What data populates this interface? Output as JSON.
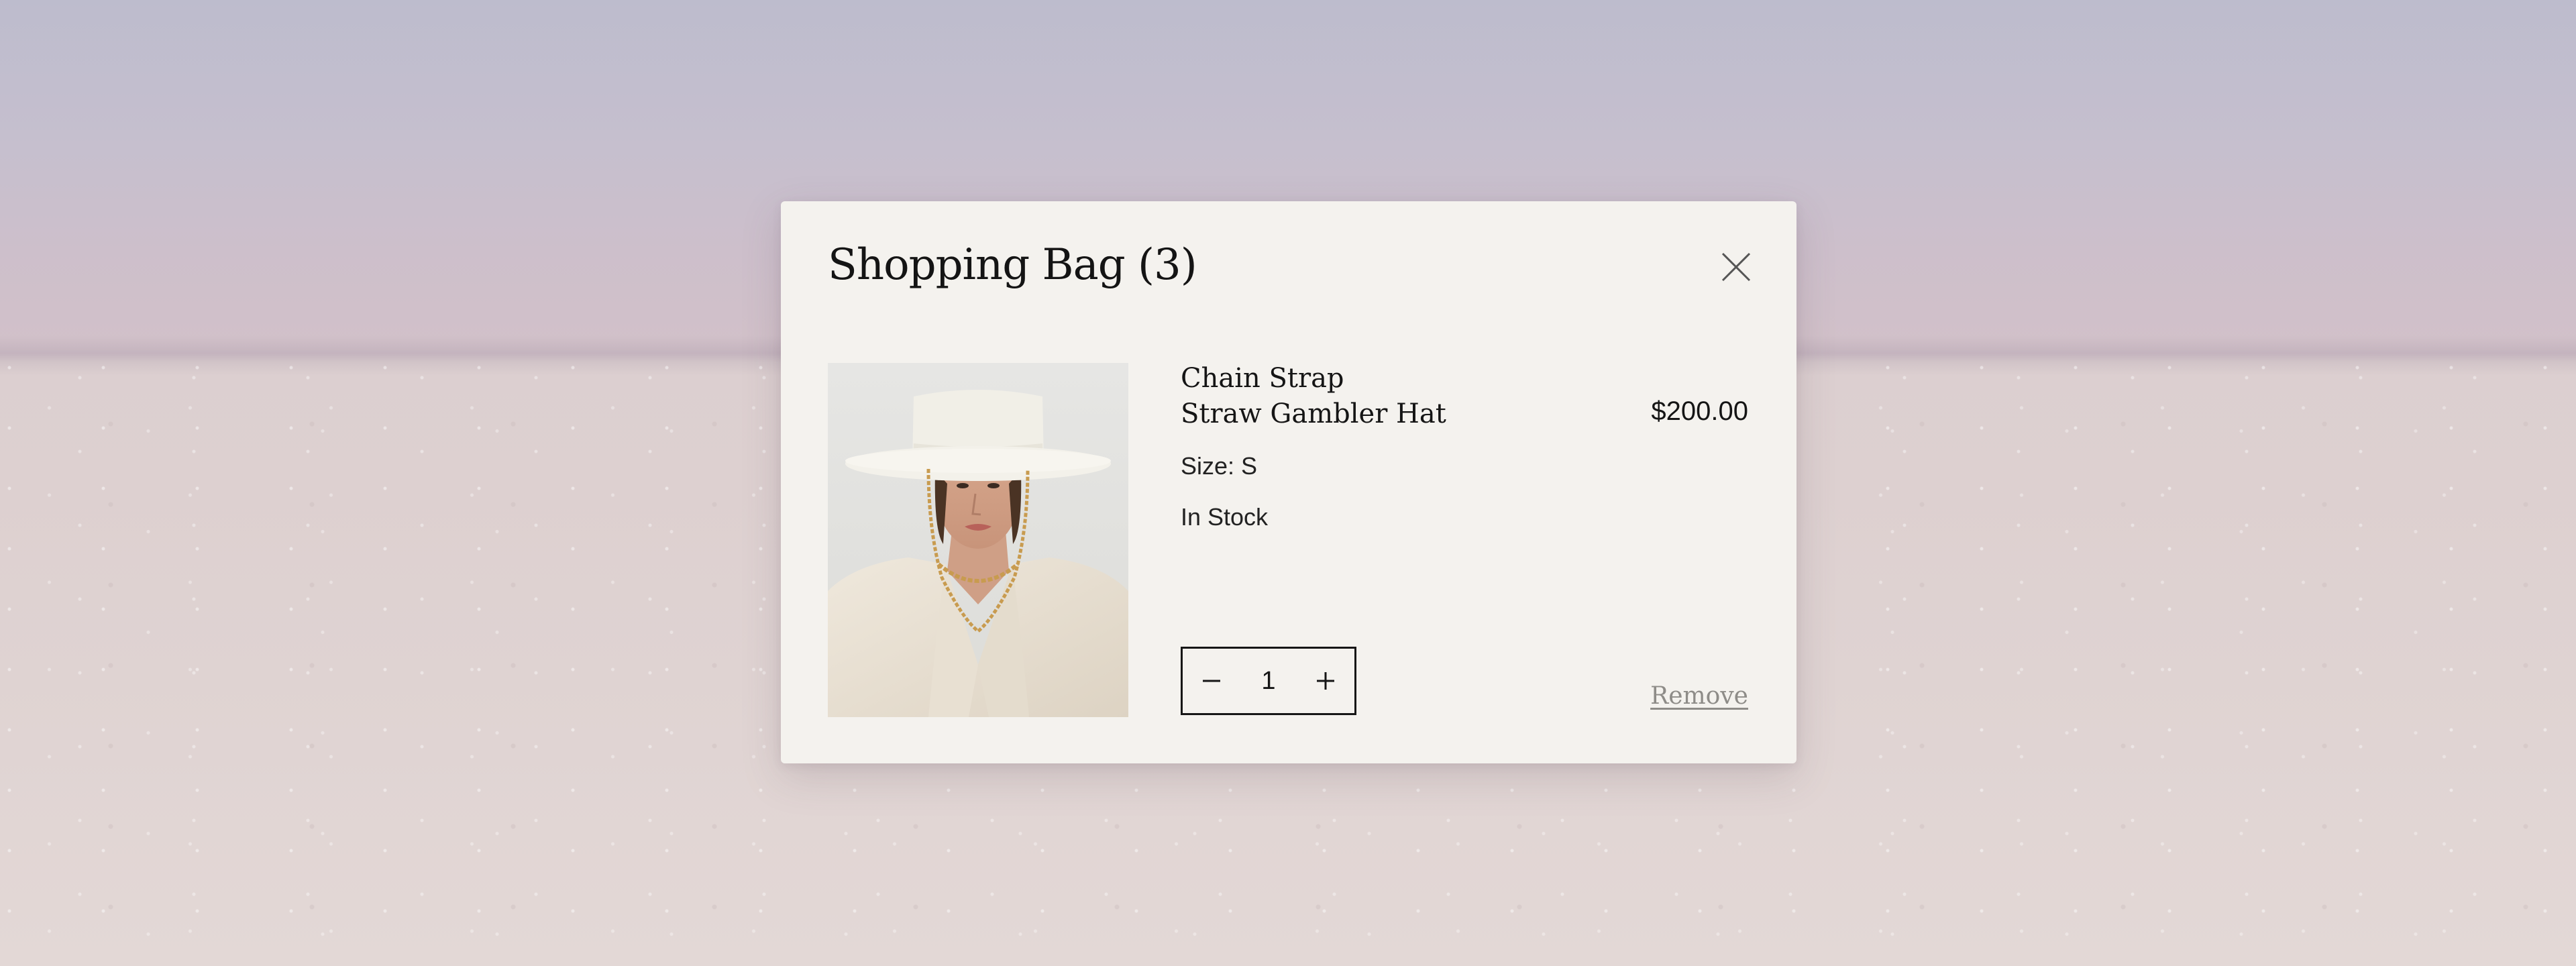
{
  "cart": {
    "title": "Shopping Bag (3)",
    "close_icon": "close-icon"
  },
  "item": {
    "name_line1": "Chain Strap",
    "name_line2": "Straw Gambler Hat",
    "price": "$200.00",
    "size": "Size: S",
    "stock": "In Stock",
    "image": "hat-model-photo",
    "quantity": "1",
    "decrease_icon": "minus-icon",
    "increase_icon": "plus-icon",
    "remove_label": "Remove"
  },
  "colors": {
    "modal_bg": "#f4f2ee",
    "text": "#151515",
    "muted": "#8e8c88"
  }
}
